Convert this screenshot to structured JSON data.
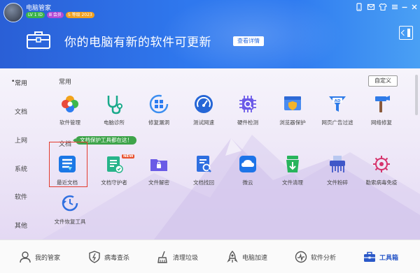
{
  "app": {
    "name": "电脑管家"
  },
  "badges": [
    "LV 1 ID",
    "Ⅲ 会员",
    "S 等级 2023"
  ],
  "header": {
    "headline": "你的电脑有新的软件可更新",
    "detail_button": "查看详情"
  },
  "sidebar": {
    "items": [
      {
        "label": "常用",
        "active": true
      },
      {
        "label": "文档"
      },
      {
        "label": "上网"
      },
      {
        "label": "系统"
      },
      {
        "label": "软件"
      },
      {
        "label": "其他"
      }
    ]
  },
  "sections": {
    "common": "常用",
    "docs": "文档",
    "custom_button": "自定义",
    "docs_tooltip": "文档保护工具都在这！"
  },
  "common_tools": [
    "软件管理",
    "电脑诊所",
    "修复漏洞",
    "测试网速",
    "硬件检测",
    "浏览器保护",
    "网页广告过滤",
    "网络修复"
  ],
  "doc_tools": [
    "最近文档",
    "文档守护者",
    "文件解密",
    "文档找回",
    "微云",
    "文件清理",
    "文件粉碎",
    "勒索病毒免疫",
    "文件恢复工具"
  ],
  "new_tag": "NEW",
  "bottom_nav": [
    {
      "label": "我的管家"
    },
    {
      "label": "病毒查杀"
    },
    {
      "label": "清理垃圾"
    },
    {
      "label": "电脑加速"
    },
    {
      "label": "软件分析"
    },
    {
      "label": "工具箱",
      "active": true
    }
  ],
  "colors": {
    "accent": "#2f78ee",
    "selection": "#e23b2e",
    "tooltip": "#3ea44a"
  }
}
